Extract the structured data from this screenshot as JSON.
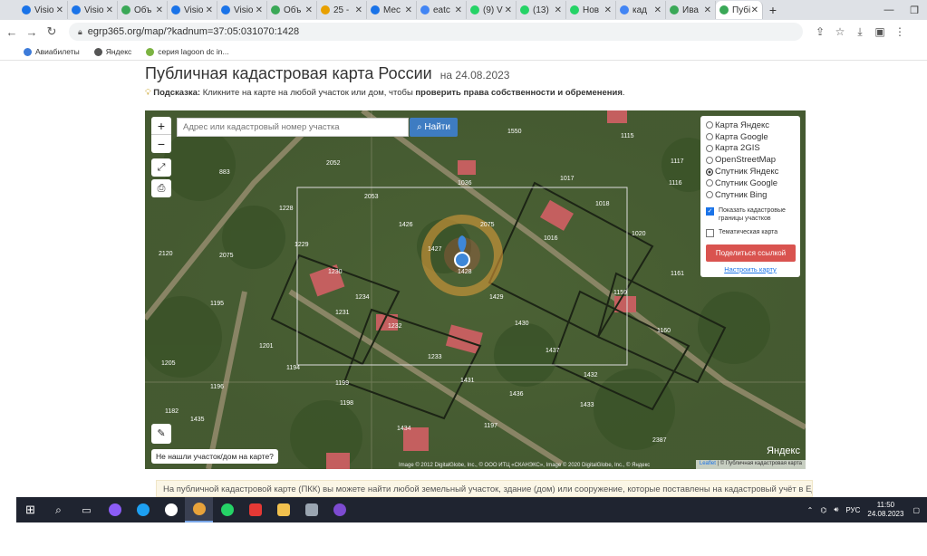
{
  "tabs": [
    {
      "label": "Visio",
      "color": "#1a73e8"
    },
    {
      "label": "Visio",
      "color": "#1a73e8"
    },
    {
      "label": "Объ",
      "color": "#3aa857"
    },
    {
      "label": "Visio",
      "color": "#1a73e8"
    },
    {
      "label": "Visio",
      "color": "#1a73e8"
    },
    {
      "label": "Объ",
      "color": "#3aa857"
    },
    {
      "label": "25 -",
      "color": "#e8a000"
    },
    {
      "label": "Мес",
      "color": "#1a73e8"
    },
    {
      "label": "eatc",
      "color": "#4285f4"
    },
    {
      "label": "(9) V",
      "color": "#25d366"
    },
    {
      "label": "(13)",
      "color": "#25d366"
    },
    {
      "label": "Нов",
      "color": "#25d366"
    },
    {
      "label": "кад",
      "color": "#4285f4"
    },
    {
      "label": "Ива",
      "color": "#3aa857"
    },
    {
      "label": "Пубі",
      "color": "#3aa857"
    }
  ],
  "address": {
    "url": "egrp365.org/map/?kadnum=37:05:031070:1428"
  },
  "bookmarks": [
    {
      "label": "Авиабилеты",
      "color": "#3d7bd9"
    },
    {
      "label": "Яндекс",
      "color": "#555"
    },
    {
      "label": "серия lagoon dc in...",
      "color": "#7cb342"
    }
  ],
  "page": {
    "title": "Публичная кадастровая карта России",
    "date": "на 24.08.2023",
    "hint_label": "Подсказка:",
    "hint_text": " Кликните на карте на любой участок или дом, чтобы ",
    "hint_bold": "проверить права собственности и обременения",
    "hint_end": ".",
    "paragraph": "На публичной кадастровой карте (ПКК) вы можете найти любой земельный участок, здание (дом) или сооружение, которые поставлены на кадастровый учёт в Едины"
  },
  "map": {
    "zoom_in": "+",
    "zoom_out": "−",
    "search_placeholder": "Адрес или кадастровый номер участка",
    "search_button": "Найти",
    "not_found": "Не нашли участок/дом на карте?",
    "yandex": "Яндекс",
    "attribution_left": "Image © 2012 DigitalGlobe, Inc., © ООО ИТЦ «СКАНЭКС», Image © 2020 DigitalGlobe, Inc., © Яндекс",
    "attribution_link": "Leaflet",
    "attribution_right": " | © Публичная кадастровая карта",
    "layers": [
      {
        "label": "Карта Яндекс",
        "selected": false
      },
      {
        "label": "Карта Google",
        "selected": false
      },
      {
        "label": "Карта 2GIS",
        "selected": false
      },
      {
        "label": "OpenStreetMap",
        "selected": false
      },
      {
        "label": "Спутник Яндекс",
        "selected": true
      },
      {
        "label": "Спутник Google",
        "selected": false
      },
      {
        "label": "Спутник Bing",
        "selected": false
      }
    ],
    "check_borders": "Показать кадастровые границы участков",
    "check_thematic": "Тематическая карта",
    "share_button": "Поделиться ссылкой",
    "configure": "Настроить карту",
    "plots": [
      "1550",
      "1115",
      "1117",
      "1116",
      "2052",
      "1036",
      "1017",
      "883",
      "2053",
      "1018",
      "1228",
      "1426",
      "2075",
      "1016",
      "1020",
      "1427",
      "1229",
      "2120",
      "2075",
      "1230",
      "1161",
      "1428",
      "1234",
      "1429",
      "1159",
      "1195",
      "1231",
      "1232",
      "1430",
      "1160",
      "1201",
      "1233",
      "1437",
      "1194",
      "1205",
      "1431",
      "1432",
      "1196",
      "1199",
      "1436",
      "1433",
      "1435",
      "1198",
      "1197",
      "2387",
      "1182",
      "1434"
    ]
  },
  "taskbar": {
    "lang": "РУС",
    "time": "11:50",
    "date": "24.08.2023"
  }
}
